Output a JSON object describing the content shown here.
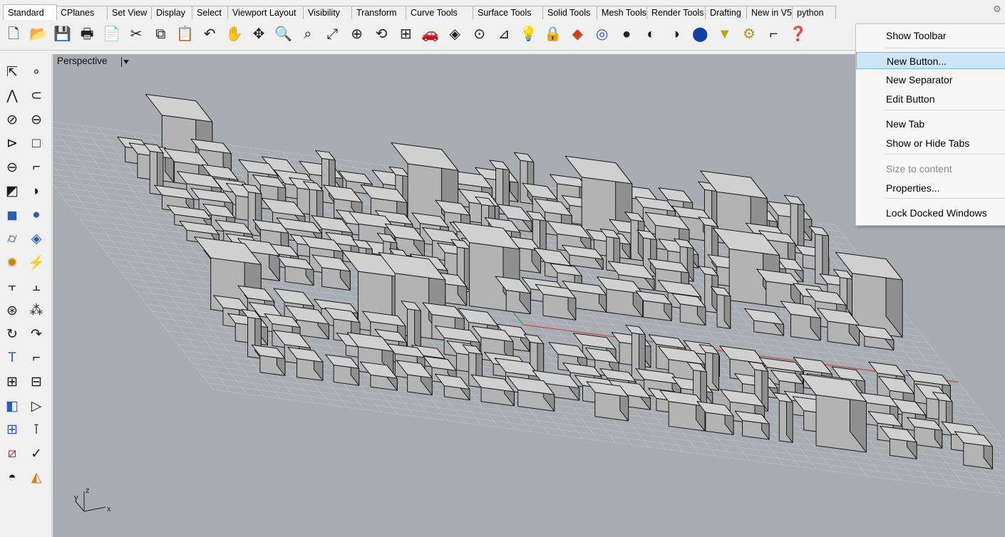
{
  "tabs": [
    "Standard",
    "CPlanes",
    "Set View",
    "Display",
    "Select",
    "Viewport Layout",
    "Visibility",
    "Transform",
    "Curve Tools",
    "Surface Tools",
    "Solid Tools",
    "Mesh Tools",
    "Render Tools",
    "Drafting",
    "New in V5",
    "python"
  ],
  "active_tab": "Standard",
  "toolbar_icons": [
    "new-file-icon",
    "open-folder-icon",
    "save-icon",
    "print-icon",
    "import-icon",
    "cut-icon",
    "copy-icon",
    "paste-icon",
    "undo-icon",
    "pan-hand-icon",
    "rotate-view-icon",
    "zoom-icon",
    "zoom-window-icon",
    "zoom-extents-icon",
    "zoom-selected-icon",
    "rotate-icon",
    "viewport-grid-icon",
    "car-icon",
    "cplane-icon",
    "snap-icon",
    "layer-icon",
    "light-icon",
    "lock-icon",
    "material-icon",
    "color-icon",
    "shaded-icon",
    "rendered-icon",
    "ghosted-icon",
    "render-sphere-icon",
    "measure-icon",
    "gear-settings-icon",
    "dimension-icon",
    "help-icon"
  ],
  "left_icons": [
    "select-arrow-icon",
    "point-icon",
    "polyline-icon",
    "curve-icon",
    "circle-icon",
    "ellipse-icon",
    "arc-icon",
    "rectangle-icon",
    "polygon-icon",
    "fillet-icon",
    "surface-icon",
    "sweep-icon",
    "box-icon",
    "sphere-icon",
    "cylinder-icon",
    "patch-icon",
    "boolean-icon",
    "explode-icon",
    "trim-icon",
    "split-icon",
    "group-icon",
    "scatter-icon",
    "offset-icon",
    "blend-icon",
    "text-icon",
    "scale-icon",
    "array-icon",
    "mirror-icon",
    "solid-edit-icon",
    "orient-icon",
    "grid-array-icon",
    "align-icon",
    "transform-icon",
    "check-icon",
    "analyze-icon",
    "render-tool-icon"
  ],
  "viewport": {
    "title": "Perspective"
  },
  "context_menu": [
    {
      "label": "Show Toolbar",
      "state": "normal"
    },
    {
      "label": "New Button...",
      "state": "highlight"
    },
    {
      "label": "New Separator",
      "state": "normal"
    },
    {
      "label": "Edit Button",
      "state": "normal"
    },
    {
      "label": "New Tab",
      "state": "normal"
    },
    {
      "label": "Show or Hide Tabs",
      "state": "normal"
    },
    {
      "label": "Size to content",
      "state": "disabled"
    },
    {
      "label": "Properties...",
      "state": "normal"
    },
    {
      "label": "Lock Docked Windows",
      "state": "normal"
    }
  ],
  "axis": {
    "z": "z",
    "y": "y",
    "x": "x"
  },
  "colors": {
    "viewport_bg": "#a8acb3",
    "grid": "#b6bac1",
    "box_top": "#d0d0d0",
    "box_front": "#b3b3b3",
    "box_side": "#8f8f8f",
    "highlight": "#cde6f7",
    "x_axis": "#c94040",
    "y_axis": "#40a040"
  }
}
